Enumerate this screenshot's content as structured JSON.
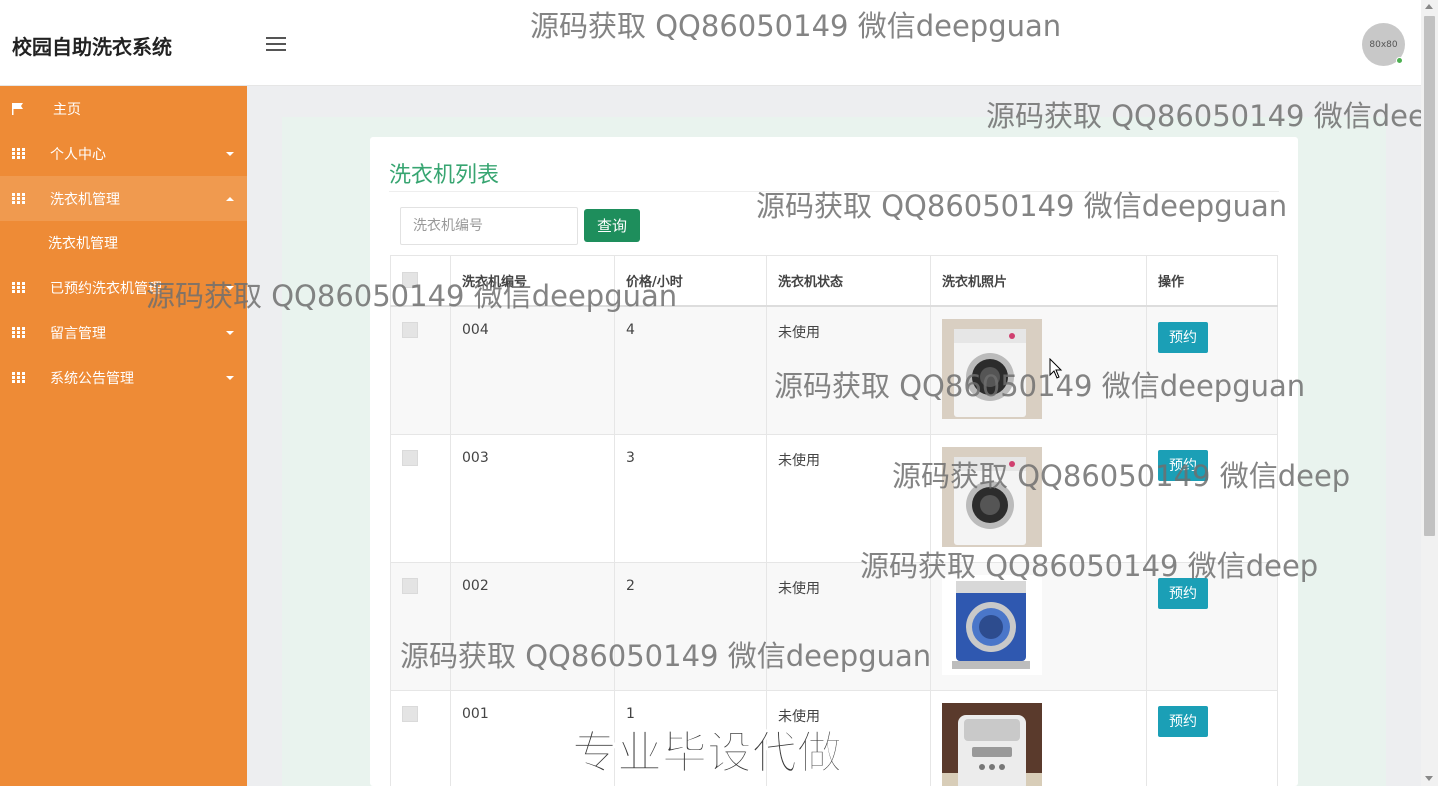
{
  "header": {
    "brand": "校园自助洗衣系统",
    "avatar_text": "80x80"
  },
  "sidebar": {
    "items": [
      {
        "label": "主页",
        "icon": "flag-icon"
      },
      {
        "label": "个人中心",
        "icon": "grid-icon"
      },
      {
        "label": "洗衣机管理",
        "icon": "grid-icon",
        "expanded": true,
        "children": [
          {
            "label": "洗衣机管理"
          }
        ]
      },
      {
        "label": "已预约洗衣机管理",
        "icon": "grid-icon"
      },
      {
        "label": "留言管理",
        "icon": "grid-icon"
      },
      {
        "label": "系统公告管理",
        "icon": "grid-icon"
      }
    ]
  },
  "main": {
    "title": "洗衣机列表",
    "search": {
      "placeholder": "洗衣机编号",
      "value": "",
      "button": "查询"
    },
    "table": {
      "columns": [
        "洗衣机编号",
        "价格/小时",
        "洗衣机状态",
        "洗衣机照片",
        "操作"
      ],
      "rows": [
        {
          "id": "004",
          "price": "4",
          "status": "未使用",
          "photo": "front-load-washer",
          "action": "预约"
        },
        {
          "id": "003",
          "price": "3",
          "status": "未使用",
          "photo": "front-load-washer",
          "action": "预约"
        },
        {
          "id": "002",
          "price": "2",
          "status": "未使用",
          "photo": "blue-washer",
          "action": "预约"
        },
        {
          "id": "001",
          "price": "1",
          "status": "未使用",
          "photo": "top-load-washer",
          "action": "预约"
        }
      ]
    }
  },
  "overlay": {
    "watermark": "源码获取 QQ86050149 微信deepguan",
    "watermark_cut": "源码获取 QQ86050149 微信deep",
    "banner": "专业毕设代做"
  },
  "colors": {
    "sidebar": "#ee8b36",
    "accent": "#37a571",
    "search_button": "#1e8e5c",
    "book_button": "#1b9fb6"
  }
}
